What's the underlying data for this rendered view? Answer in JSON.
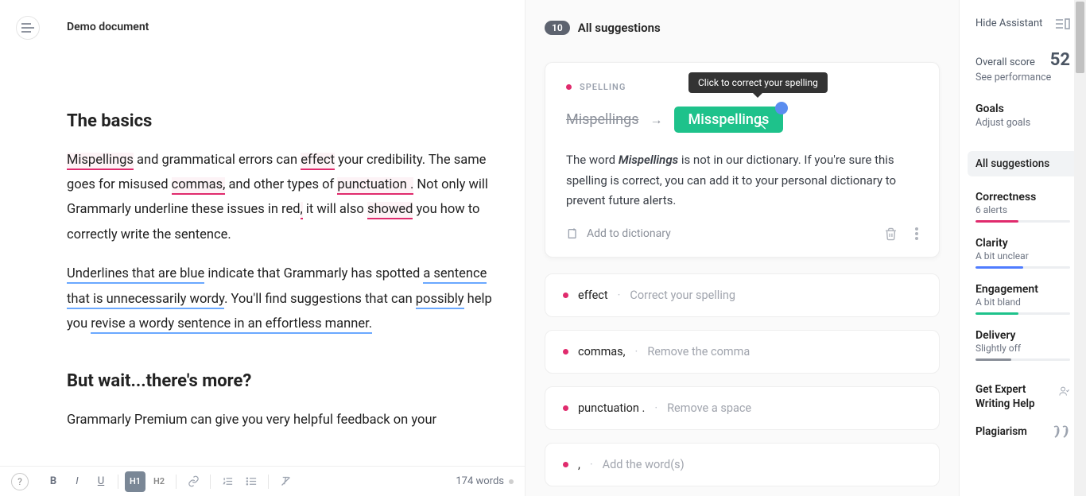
{
  "document": {
    "title": "Demo document",
    "h1": "The basics",
    "p1a": "Mispellings",
    "p1b": " and grammatical errors can ",
    "p1c": "effect",
    "p1d": " your credibility. The same goes for misused ",
    "p1e": "commas,",
    "p1f": " and other types of ",
    "p1g": "punctuation .",
    "p1h": " Not only will Grammarly underline these issues in red",
    "p1i": ",",
    "p1j": " it will also ",
    "p1k": "showed",
    "p1l": " you how to correctly write the sentence.",
    "p2a": "Underlines that are blue",
    "p2b": " indicate that Grammarly has spotted ",
    "p2c": "a sentence that is unnecessarily wordy",
    "p2d": ". You'll find suggestions that can ",
    "p2e": "possibly",
    "p2f": " help you ",
    "p2g": "revise a wordy sentence in an effortless manner.",
    "h2": "But wait...there's more?",
    "p3": "Grammarly Premium can give you very helpful feedback on your",
    "word_count": "174 words"
  },
  "toolbar": {
    "bold": "B",
    "italic": "I",
    "underline": "U",
    "h1": "H1",
    "h2": "H2"
  },
  "suggestions": {
    "count": "10",
    "title": "All suggestions",
    "card": {
      "category": "SPELLING",
      "tooltip": "Click to correct your spelling",
      "original": "Mispellings",
      "fix": "Misspellings",
      "desc_before": "The word ",
      "desc_word": "Mispellings",
      "desc_after": " is not in our dictionary. If you're sure this spelling is correct, you can add it to your personal dictionary to prevent future alerts.",
      "add_dict": "Add to dictionary"
    },
    "rows": [
      {
        "word": "effect",
        "hint": "Correct your spelling"
      },
      {
        "word": "commas,",
        "hint": "Remove the comma"
      },
      {
        "word": "punctuation .",
        "hint": "Remove a space"
      },
      {
        "word": ",",
        "hint": "Add the word(s)"
      }
    ]
  },
  "sidebar": {
    "hide": "Hide Assistant",
    "overall_label": "Overall score",
    "overall_value": "52",
    "see_perf": "See performance",
    "goals": "Goals",
    "goals_sub": "Adjust goals",
    "all": "All suggestions",
    "metrics": {
      "correctness": {
        "name": "Correctness",
        "sub": "6 alerts"
      },
      "clarity": {
        "name": "Clarity",
        "sub": "A bit unclear"
      },
      "engagement": {
        "name": "Engagement",
        "sub": "A bit bland"
      },
      "delivery": {
        "name": "Delivery",
        "sub": "Slightly off"
      }
    },
    "expert": "Get Expert Writing Help",
    "plagiarism": "Plagiarism"
  }
}
